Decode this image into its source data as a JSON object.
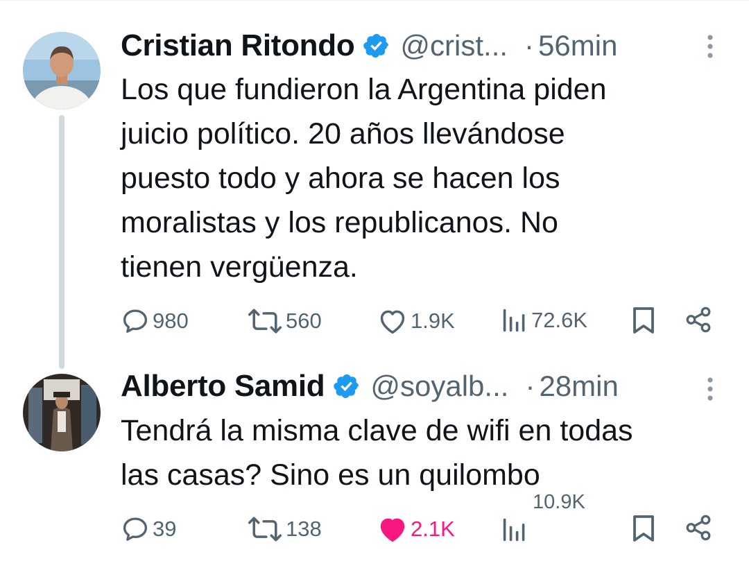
{
  "tweets": [
    {
      "display_name": "Cristian Ritondo",
      "handle": "@crist...",
      "separator": "·",
      "time": "56min",
      "text_lines": [
        "Los que fundieron la Argentina piden",
        "juicio político. 20 años llevándose",
        "puesto todo y ahora se hacen los",
        "moralistas y los republicanos. No",
        "tienen vergüenza."
      ],
      "actions": {
        "replies": "980",
        "reposts": "560",
        "likes": "1.9K",
        "views": "72.6K"
      },
      "liked": false
    },
    {
      "display_name": "Alberto Samid",
      "handle": "@soyalb...",
      "separator": "·",
      "time": "28min",
      "text_lines": [
        "Tendrá la misma clave de wifi en todas",
        "las casas? Sino es un quilombo"
      ],
      "actions": {
        "replies": "39",
        "reposts": "138",
        "likes": "2.1K",
        "views": "10.9K"
      },
      "liked": true
    }
  ],
  "icons": {
    "reply": "speech-bubble-icon",
    "repost": "repost-arrows-icon",
    "like": "heart-icon",
    "views": "bar-chart-icon",
    "bookmark": "bookmark-icon",
    "share": "share-icon",
    "more": "vertical-ellipsis-icon",
    "verified": "verified-badge-icon"
  },
  "colors": {
    "text": "#0f1419",
    "secondary": "#536471",
    "verified": "#1d9bf0",
    "like_active": "#f91880",
    "thread_line": "#cfd9de"
  }
}
